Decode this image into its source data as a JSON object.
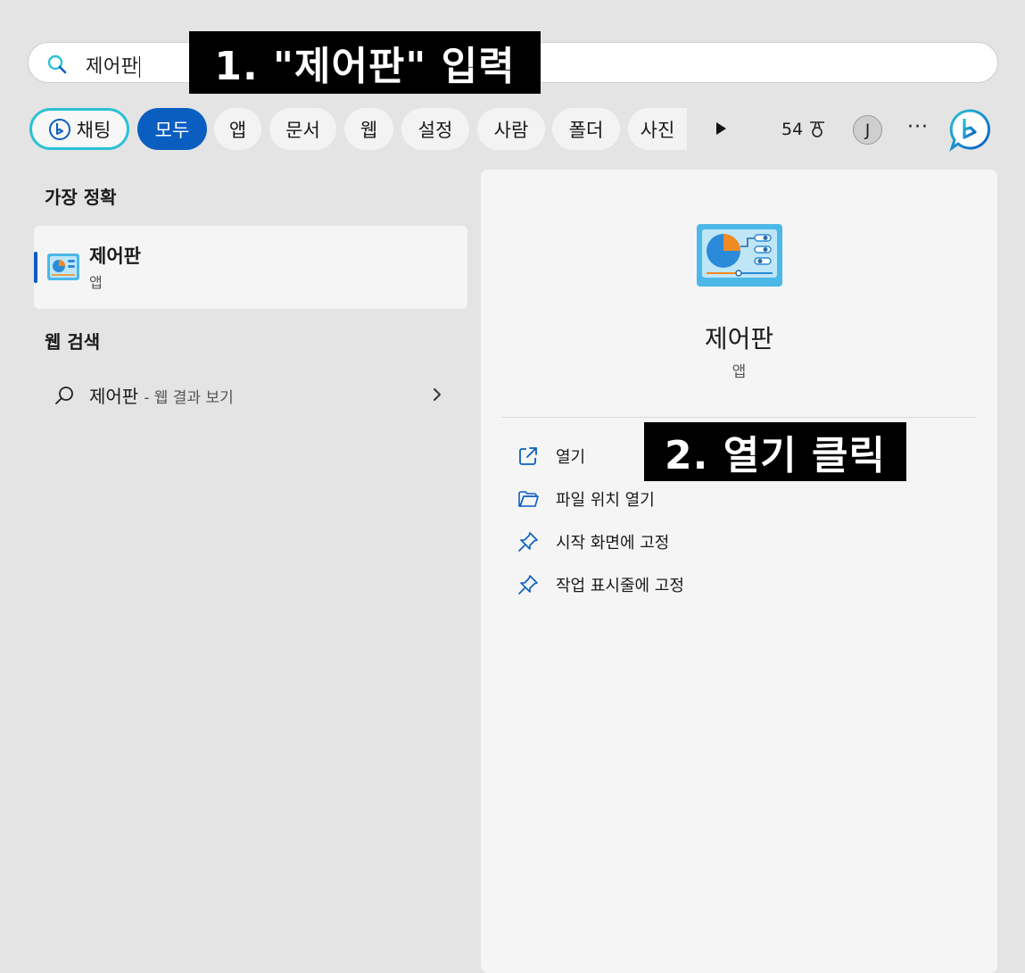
{
  "search": {
    "query": "제어판"
  },
  "annotations": {
    "step1": "1. \"제어판\" 입력",
    "step2": "2. 열기 클릭"
  },
  "tabs": {
    "chat": "채팅",
    "all": "모두",
    "apps": "앱",
    "documents": "문서",
    "web": "웹",
    "settings": "설정",
    "people": "사람",
    "folders": "폴더",
    "photos": "사진"
  },
  "rewards": {
    "points": "54"
  },
  "profile": {
    "initial": "J"
  },
  "more": {
    "label": "···"
  },
  "best_match": {
    "heading": "가장 정확",
    "title": "제어판",
    "subtitle": "앱"
  },
  "web_search": {
    "heading": "웹 검색",
    "term": "제어판",
    "suffix": "- 웹 결과 보기"
  },
  "detail": {
    "title": "제어판",
    "subtitle": "앱",
    "actions": {
      "open": "열기",
      "open_location": "파일 위치 열기",
      "pin_start": "시작 화면에 고정",
      "pin_taskbar": "작업 표시줄에 고정"
    }
  },
  "colors": {
    "accent": "#0a5ec0",
    "chat_border": "#2cc1d6",
    "annotation_bg": "#000000"
  }
}
